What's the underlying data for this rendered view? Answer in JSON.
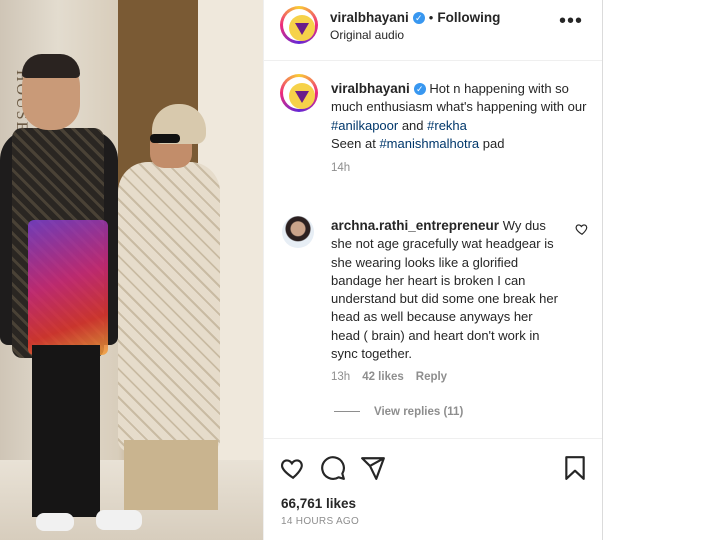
{
  "post": {
    "photo_sign_text": "HOUSE"
  },
  "header": {
    "username": "viralbhayani",
    "separator": "•",
    "follow_label": "Following",
    "audio": "Original audio",
    "more_label": "•••"
  },
  "caption": {
    "username": "viralbhayani",
    "text_part1": "Hot n happening with so much enthusiasm what's happening with our ",
    "hashtag1": "#anilkapoor",
    "text_part2": " and ",
    "hashtag2": "#rekha",
    "text_part3": "Seen at ",
    "hashtag3": "#manishmalhotra",
    "text_part4": " pad",
    "time": "14h"
  },
  "comment": {
    "username": "archna.rathi_entrepreneur",
    "text": "Wy dus she not age gracefully wat headgear is she wearing looks like a glorified bandage her heart is broken I can understand but did some one break her head as well because anyways her head ( brain) and heart don't work in sync together.",
    "time": "13h",
    "likes": "42 likes",
    "reply_label": "Reply",
    "view_replies": "View replies (11)"
  },
  "actions": {
    "like_icon": "heart-icon",
    "comment_icon": "comment-icon",
    "share_icon": "share-icon",
    "save_icon": "bookmark-icon"
  },
  "stats": {
    "likes": "66,761 likes",
    "posted": "14 HOURS AGO"
  },
  "colors": {
    "hashtag": "#00376b",
    "verified": "#3897f0",
    "muted": "#8e8e8e"
  }
}
